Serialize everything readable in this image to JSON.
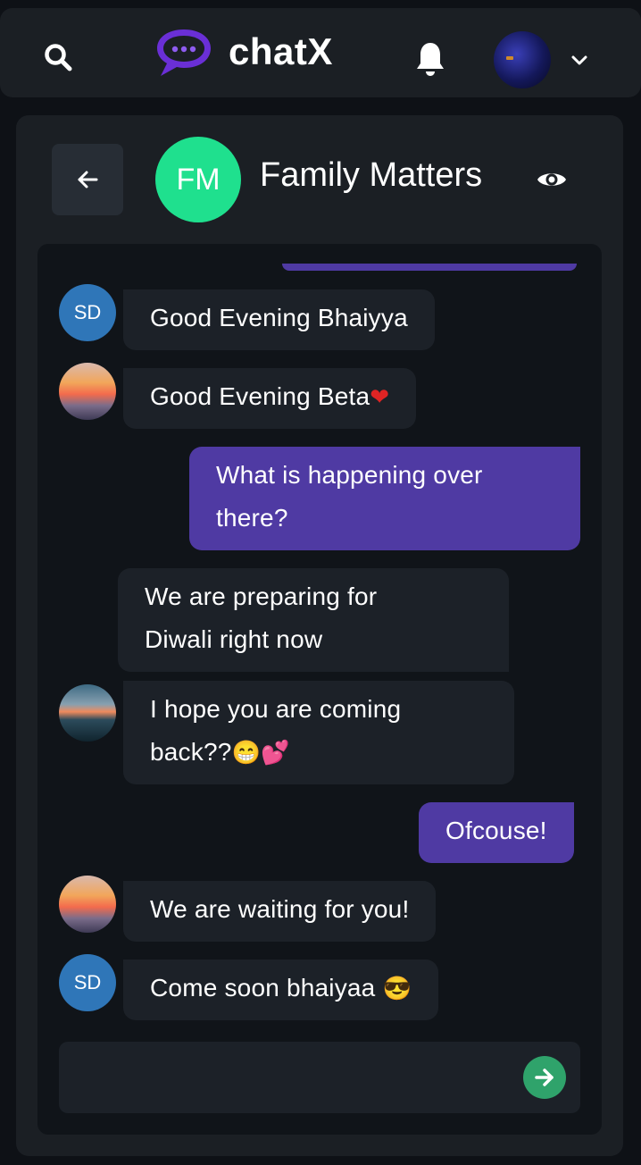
{
  "header": {
    "app_name": "chatX",
    "icons": {
      "search": "search-icon",
      "logo": "chat-bubble-logo-icon",
      "notifications": "bell-icon",
      "profile": "avatar",
      "menu": "chevron-down-icon"
    },
    "colors": {
      "accent": "#6a2fd6"
    }
  },
  "chat": {
    "avatar_initials": "FM",
    "title": "Family Matters",
    "icons": {
      "back": "arrow-left-icon",
      "view": "eye-icon"
    },
    "colors": {
      "avatar_bg": "#1fe08e",
      "outgoing_bubble": "#4f3aa3",
      "incoming_bubble": "#1c2128"
    }
  },
  "messages": [
    {
      "sender": "SD",
      "avatar": "initials",
      "direction": "in",
      "text": "Good Evening Bhaiyya",
      "emoji": ""
    },
    {
      "sender": "",
      "avatar": "sunset-photo",
      "direction": "in",
      "text": "Good Evening Beta",
      "emoji": "❤"
    },
    {
      "sender": "",
      "avatar": "",
      "direction": "out",
      "text": "What is happening over there?",
      "line1": "What is happening over",
      "line2": "there?"
    },
    {
      "sender": "",
      "avatar": "",
      "direction": "in",
      "text": "We are preparing for Diwali right now",
      "line1": "We are preparing for",
      "line2": "Diwali right now"
    },
    {
      "sender": "",
      "avatar": "forest-photo",
      "direction": "in",
      "text": "I hope you are coming back??",
      "line1": "I hope you are coming",
      "line2": "back??",
      "emoji": "😁💕"
    },
    {
      "sender": "",
      "avatar": "",
      "direction": "out",
      "text": "Ofcouse!"
    },
    {
      "sender": "",
      "avatar": "sunset-photo",
      "direction": "in",
      "text": "We are waiting for you!"
    },
    {
      "sender": "SD",
      "avatar": "initials",
      "direction": "in",
      "text": "Come soon bhaiyaa",
      "emoji": "😎"
    }
  ],
  "composer": {
    "value": "",
    "placeholder": "",
    "send_icon": "arrow-right-icon"
  }
}
